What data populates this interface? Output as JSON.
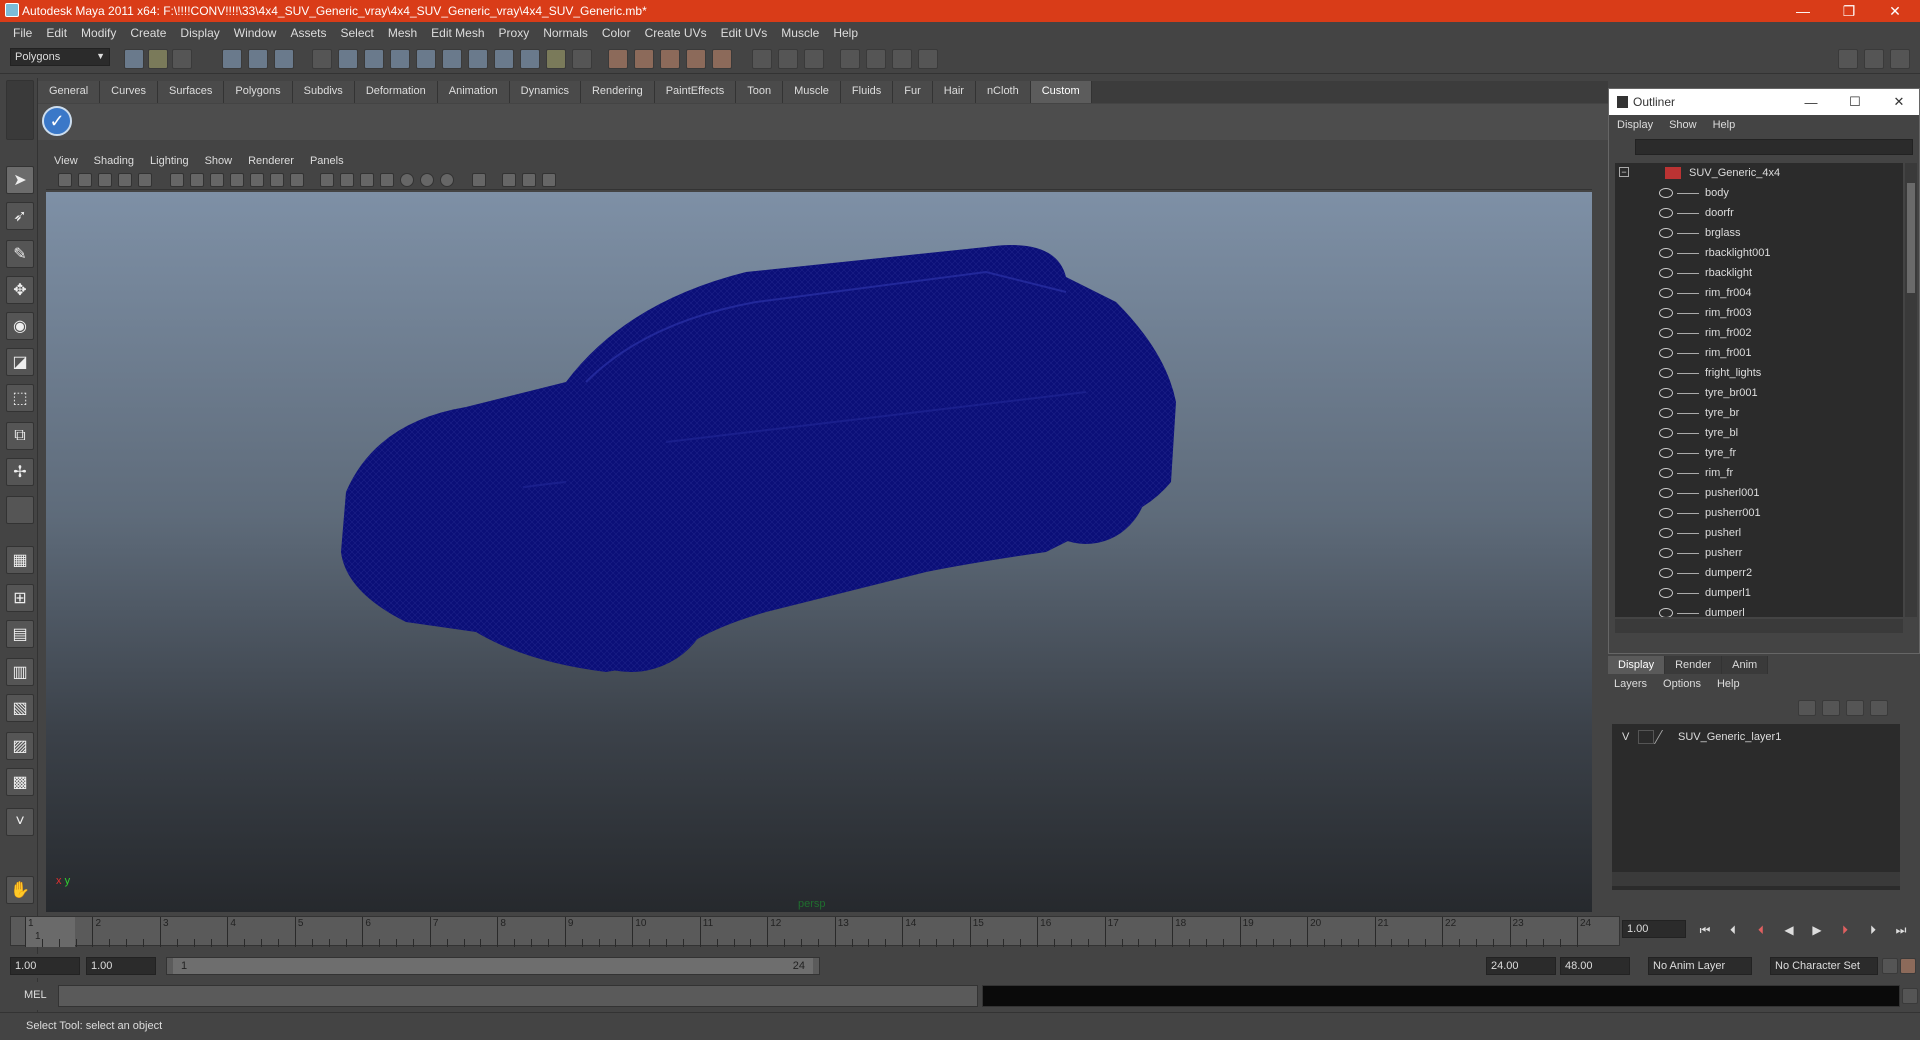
{
  "window": {
    "title": "Autodesk Maya 2011 x64: F:\\!!!!CONV!!!!\\33\\4x4_SUV_Generic_vray\\4x4_SUV_Generic_vray\\4x4_SUV_Generic.mb*"
  },
  "menubar": [
    "File",
    "Edit",
    "Modify",
    "Create",
    "Display",
    "Window",
    "Assets",
    "Select",
    "Mesh",
    "Edit Mesh",
    "Proxy",
    "Normals",
    "Color",
    "Create UVs",
    "Edit UVs",
    "Muscle",
    "Help"
  ],
  "mode_selector": "Polygons",
  "shelf_tabs": [
    "General",
    "Curves",
    "Surfaces",
    "Polygons",
    "Subdivs",
    "Deformation",
    "Animation",
    "Dynamics",
    "Rendering",
    "PaintEffects",
    "Toon",
    "Muscle",
    "Fluids",
    "Fur",
    "Hair",
    "nCloth",
    "Custom"
  ],
  "shelf_active": "Custom",
  "viewport": {
    "menu": [
      "View",
      "Shading",
      "Lighting",
      "Show",
      "Renderer",
      "Panels"
    ],
    "camera_label": "persp",
    "axis_x": "x",
    "axis_y": "y",
    "model_color": "#0b0f78"
  },
  "outliner": {
    "title": "Outliner",
    "menu": [
      "Display",
      "Show",
      "Help"
    ],
    "root": "SUV_Generic_4x4",
    "items": [
      "body",
      "doorfr",
      "brglass",
      "rbacklight001",
      "rbacklight",
      "rim_fr004",
      "rim_fr003",
      "rim_fr002",
      "rim_fr001",
      "fright_lights",
      "tyre_br001",
      "tyre_br",
      "tyre_bl",
      "tyre_fr",
      "rim_fr",
      "pusherl001",
      "pusherr001",
      "pusherl",
      "pusherr",
      "dumperr2",
      "dumperl1",
      "dumperl"
    ]
  },
  "layer_editor": {
    "tabs": [
      "Display",
      "Render",
      "Anim"
    ],
    "active_tab": "Display",
    "menu": [
      "Layers",
      "Options",
      "Help"
    ],
    "layers": [
      {
        "visible": "V",
        "name": "SUV_Generic_layer1"
      }
    ]
  },
  "timeline": {
    "ticks": [
      "1",
      "2",
      "3",
      "4",
      "5",
      "6",
      "7",
      "8",
      "9",
      "10",
      "11",
      "12",
      "13",
      "14",
      "15",
      "16",
      "17",
      "18",
      "19",
      "20",
      "21",
      "22",
      "23",
      "24"
    ],
    "current_frame_marker": "1",
    "current_frame": "1.00"
  },
  "range": {
    "start": "1.00",
    "playback_start": "1.00",
    "slider_start": "1",
    "slider_end": "24",
    "playback_end": "24.00",
    "end": "48.00",
    "anim_layer": "No Anim Layer",
    "character_set": "No Character Set"
  },
  "command_line": {
    "label": "MEL"
  },
  "help_line": "Select Tool: select an object"
}
